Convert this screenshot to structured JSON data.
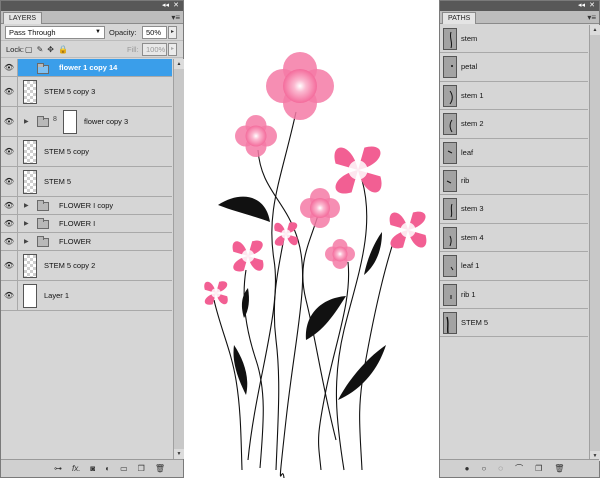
{
  "layers_panel": {
    "tab": "LAYERS",
    "blend_mode": "Pass Through",
    "opacity_label": "Opacity:",
    "opacity_value": "50%",
    "lock_label": "Lock:",
    "fill_label": "Fill:",
    "fill_value": "100%",
    "layers": [
      {
        "name": "flower 1 copy 14",
        "type": "group",
        "selected": true
      },
      {
        "name": "STEM 5 copy 3",
        "type": "layer"
      },
      {
        "name": "flower copy 3",
        "type": "group-mask"
      },
      {
        "name": "STEM 5 copy",
        "type": "layer"
      },
      {
        "name": "STEM 5",
        "type": "layer"
      },
      {
        "name": "FLOWER I copy",
        "type": "group"
      },
      {
        "name": "FLOWER I",
        "type": "group"
      },
      {
        "name": "FLOWER",
        "type": "group"
      },
      {
        "name": "STEM 5 copy 2",
        "type": "layer"
      },
      {
        "name": "Layer 1",
        "type": "layer-white"
      }
    ],
    "bottom_icons": [
      "link-icon",
      "fx-icon",
      "mask-icon",
      "adjustment-icon",
      "new-group-icon",
      "new-layer-icon",
      "trash-icon"
    ]
  },
  "paths_panel": {
    "tab": "PATHS",
    "paths": [
      "stem",
      "petal",
      "stem 1",
      "stem 2",
      "leaf",
      "rib",
      "stem 3",
      "stem 4",
      "leaf 1",
      "rib 1",
      "STEM 5"
    ],
    "bottom_icons": [
      "fill-path-icon",
      "stroke-path-icon",
      "load-selection-icon",
      "work-path-icon",
      "new-path-icon",
      "trash-icon"
    ]
  },
  "colors": {
    "selection": "#3a9eea",
    "petal": "#f46c9c",
    "ink": "#111111",
    "panel_bg": "#d6d6d6"
  }
}
